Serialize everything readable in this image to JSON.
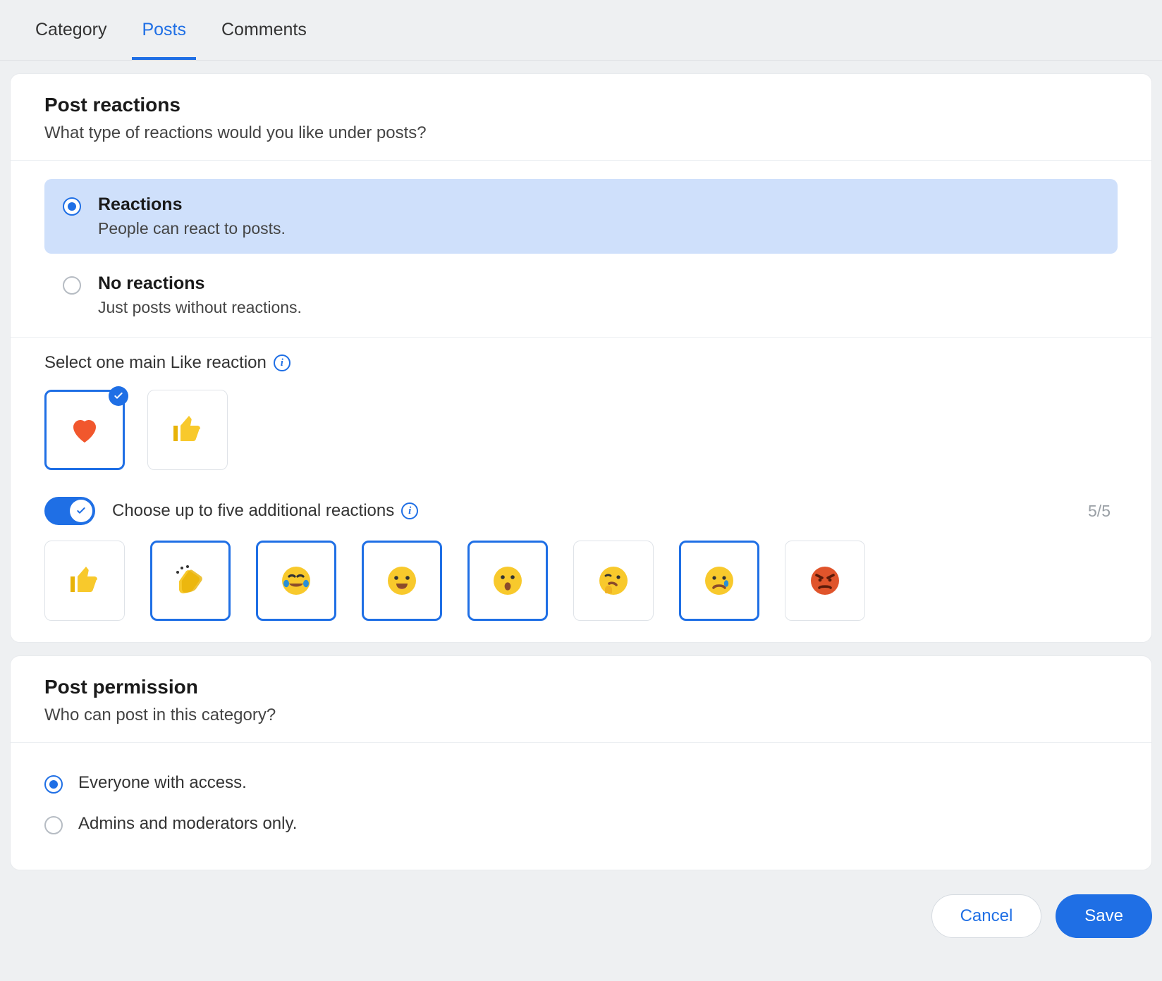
{
  "tabs": {
    "category": "Category",
    "posts": "Posts",
    "comments": "Comments"
  },
  "reactions": {
    "title": "Post reactions",
    "subtitle": "What type of reactions would you like under posts?",
    "options": {
      "yes": {
        "title": "Reactions",
        "sub": "People can react to posts.",
        "selected": true
      },
      "no": {
        "title": "No reactions",
        "sub": "Just posts without reactions.",
        "selected": false
      }
    },
    "main_like": {
      "label": "Select one main Like reaction",
      "choices": [
        {
          "id": "heart",
          "selected": true
        },
        {
          "id": "thumbs-up",
          "selected": false
        }
      ]
    },
    "additional": {
      "enabled": true,
      "label": "Choose up to five additional reactions",
      "counter": "5/5",
      "choices": [
        {
          "id": "thumbs-up",
          "selected": false
        },
        {
          "id": "clap",
          "selected": true
        },
        {
          "id": "joy",
          "selected": true
        },
        {
          "id": "grin",
          "selected": true
        },
        {
          "id": "wow",
          "selected": true
        },
        {
          "id": "thinking",
          "selected": false
        },
        {
          "id": "tear",
          "selected": true
        },
        {
          "id": "angry",
          "selected": false
        }
      ]
    }
  },
  "permission": {
    "title": "Post permission",
    "subtitle": "Who can post in this category?",
    "options": {
      "everyone": {
        "label": "Everyone with access.",
        "selected": true
      },
      "admins": {
        "label": "Admins and moderators only.",
        "selected": false
      }
    }
  },
  "footer": {
    "cancel": "Cancel",
    "save": "Save"
  }
}
